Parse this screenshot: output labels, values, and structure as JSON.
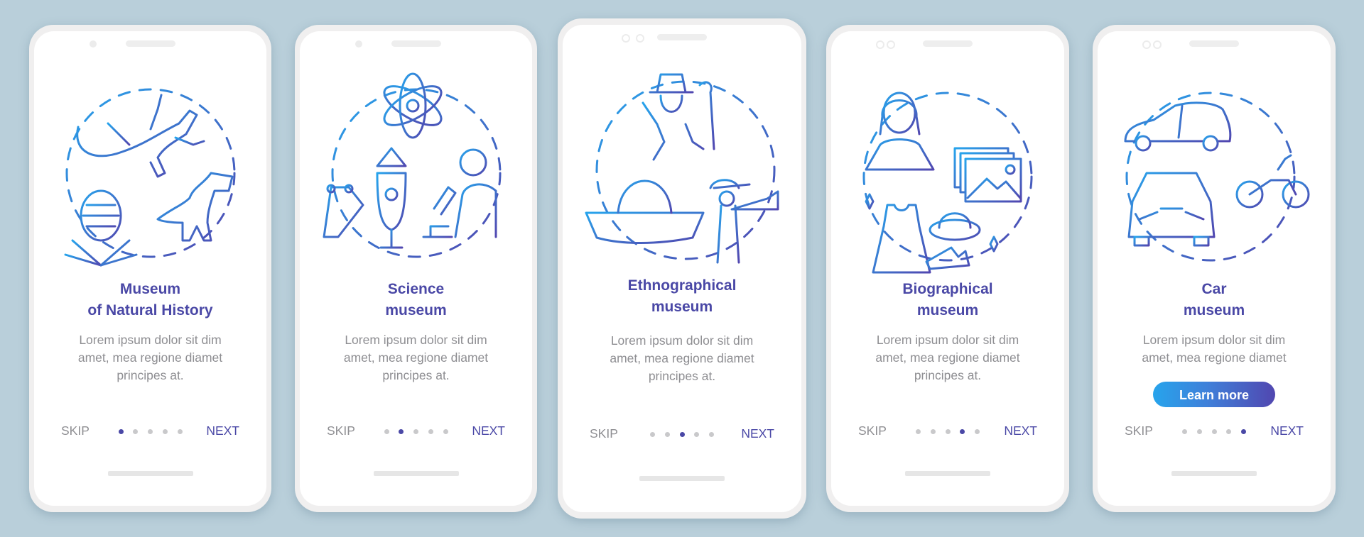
{
  "colors": {
    "background": "#b9cfda",
    "title": "#4a48a6",
    "body_text": "#8e8e92",
    "dot_inactive": "#c9c9cb",
    "dot_active": "#4a48a6",
    "gradient_start": "#27a4ec",
    "gradient_end": "#5147b0"
  },
  "screens": [
    {
      "title_line1": "Museum",
      "title_line2": "of Natural History",
      "description_line1": "Lorem ipsum dolor sit dim",
      "description_line2": "amet, mea regione diamet",
      "description_line3": "principes at.",
      "illustration": [
        "lizard-icon",
        "dinosaur-icon",
        "plant-icon"
      ],
      "skip_label": "SKIP",
      "next_label": "NEXT",
      "active_page": 1,
      "total_pages": 5
    },
    {
      "title_line1": "Science",
      "title_line2": "museum",
      "description_line1": "Lorem ipsum dolor sit dim",
      "description_line2": "amet, mea regione diamet",
      "description_line3": "principes at.",
      "illustration": [
        "atom-icon",
        "robot-arm-icon",
        "rocket-icon",
        "microscope-icon",
        "scientist-icon"
      ],
      "skip_label": "SKIP",
      "next_label": "NEXT",
      "active_page": 2,
      "total_pages": 5
    },
    {
      "title_line1": "Ethnographical",
      "title_line2": "museum",
      "description_line1": "Lorem ipsum dolor sit dim",
      "description_line2": "amet, mea regione diamet",
      "description_line3": "principes at.",
      "illustration": [
        "leprechaun-icon",
        "sombrero-icon",
        "trumpet-player-icon"
      ],
      "skip_label": "SKIP",
      "next_label": "NEXT",
      "active_page": 3,
      "total_pages": 5
    },
    {
      "title_line1": "Biographical",
      "title_line2": "museum",
      "description_line1": "Lorem ipsum dolor sit dim",
      "description_line2": "amet, mea regione diamet",
      "description_line3": "principes at.",
      "illustration": [
        "woman-portrait-icon",
        "photos-icon",
        "dress-icon",
        "hat-icon",
        "shoes-icon"
      ],
      "skip_label": "SKIP",
      "next_label": "NEXT",
      "active_page": 4,
      "total_pages": 5
    },
    {
      "title_line1": "Car",
      "title_line2": "museum",
      "description_line1": "Lorem ipsum dolor sit dim",
      "description_line2": "amet, mea regione diamet",
      "button_label": "Learn more",
      "illustration": [
        "hatchback-car-icon",
        "motorcycle-icon",
        "sedan-car-icon"
      ],
      "skip_label": "SKIP",
      "next_label": "NEXT",
      "active_page": 5,
      "total_pages": 5
    }
  ]
}
